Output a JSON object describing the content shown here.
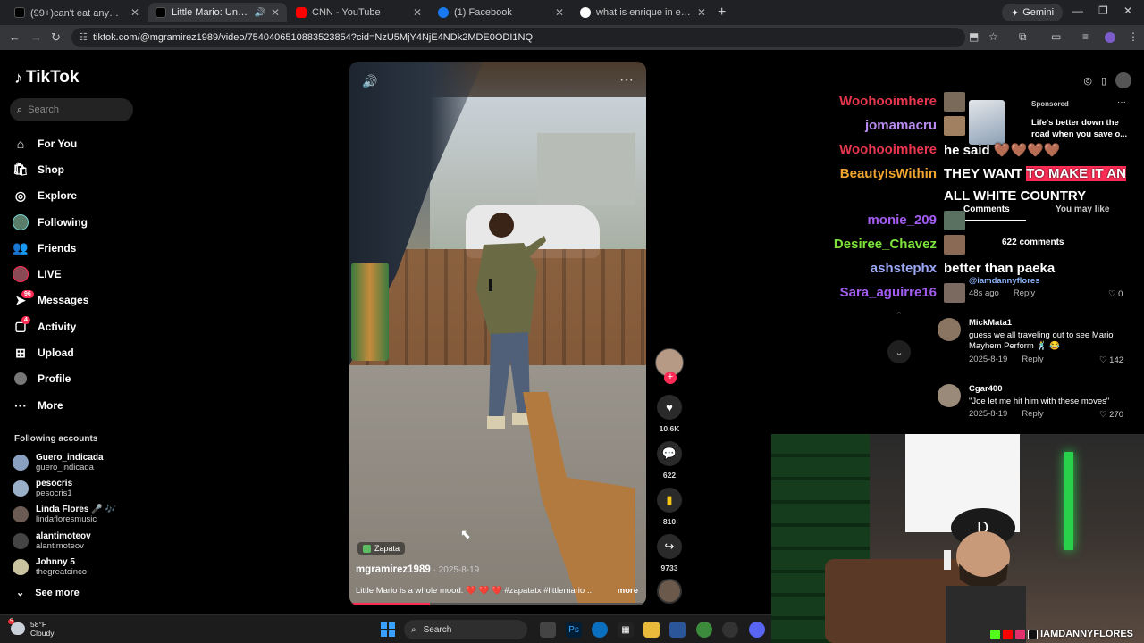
{
  "browser": {
    "tabs": [
      {
        "title": "(99+)can't eat anywhere 🤦‍♀️#fy",
        "favicon": "#000000"
      },
      {
        "title": "Little Mario: Un Mood Únic",
        "favicon": "#000000"
      },
      {
        "title": "CNN - YouTube",
        "favicon": "#ff0000"
      },
      {
        "title": "(1) Facebook",
        "favicon": "#1877f2"
      },
      {
        "title": "what is enrique in english - Go",
        "favicon": "#4285f4"
      }
    ],
    "gemini_label": "Gemini",
    "url": "tiktok.com/@mgramirez1989/video/7540406510883523854?cid=NzU5MjY4NjE4NDk2MDE0ODI1NQ"
  },
  "tiktok": {
    "logo": "TikTok",
    "search_placeholder": "Search",
    "nav": [
      {
        "label": "For You",
        "icon": "home-icon"
      },
      {
        "label": "Shop",
        "icon": "shop-icon"
      },
      {
        "label": "Explore",
        "icon": "compass-icon"
      },
      {
        "label": "Following",
        "icon": "following-icon"
      },
      {
        "label": "Friends",
        "icon": "friends-icon"
      },
      {
        "label": "LIVE",
        "icon": "live-icon"
      },
      {
        "label": "Messages",
        "icon": "messages-icon",
        "badge": "96"
      },
      {
        "label": "Activity",
        "icon": "activity-icon",
        "badge": "4"
      },
      {
        "label": "Upload",
        "icon": "upload-icon"
      },
      {
        "label": "Profile",
        "icon": "profile-icon"
      },
      {
        "label": "More",
        "icon": "more-icon"
      }
    ],
    "following_title": "Following accounts",
    "following": [
      {
        "name": "Guero_indicada",
        "handle": "guero_indicada"
      },
      {
        "name": "pesocris",
        "handle": "pesocris1"
      },
      {
        "name": "Linda Flores 🎤 🎶",
        "handle": "lindafloresmusic"
      },
      {
        "name": "alantimoteov",
        "handle": "alantimoteov"
      },
      {
        "name": "Johnny 5",
        "handle": "thegreatcinco"
      }
    ],
    "see_more": "See more",
    "video": {
      "location": "Zapata",
      "author": "mgramirez1989",
      "date": " · 2025-8-19",
      "caption": "Little Mario is a whole mood. ❤️ ❤️ ❤️ #zapatatx #littlemario ...",
      "more": "more",
      "progress": 0.27
    },
    "actions": {
      "likes": "10.6K",
      "comments": "622",
      "saves": "810",
      "shares": "9733"
    }
  },
  "stream_chat": [
    {
      "name": "Woohooimhere",
      "color": "#e8364f"
    },
    {
      "name": "jomamacru",
      "color": "#b98cf0"
    },
    {
      "name": "Woohooimhere",
      "color": "#e8364f"
    },
    {
      "name": "BeautyIsWithin",
      "color": "#f0a530"
    },
    {
      "name": "monie_209",
      "color": "#a35cf0"
    },
    {
      "name": "Desiree_Chavez",
      "color": "#7de23b"
    },
    {
      "name": "ashstephx",
      "color": "#9aa7f5"
    },
    {
      "name": "Sara_aguirre16",
      "color": "#a35cf0"
    }
  ],
  "stream_messages": {
    "m1": "he said 🤎🤎🤎🤎",
    "m2a": "THEY WANT ",
    "m2b": "TO MAKE IT AN",
    "m2c": "ALL WHITE COUNTRY",
    "m3": "better than paeka"
  },
  "comments_panel": {
    "sponsored": "Sponsored",
    "ad_text": "Life's better down the road when you save o...",
    "tab_comments": "Comments",
    "tab_you_may_like": "You may like",
    "count": "622 comments",
    "comments": [
      {
        "user": "@iamdannyflores",
        "text": "",
        "date": "48s ago",
        "reply": "Reply",
        "likes": "0"
      },
      {
        "user": "MickMata1",
        "text": "guess we all traveling out to see Mario Mayhem Perform 🕺 😂",
        "date": "2025-8-19",
        "reply": "Reply",
        "likes": "142"
      },
      {
        "user": "Cgar400",
        "text": "\"Joe let me hit him with these moves\"",
        "date": "2025-8-19",
        "reply": "Reply",
        "likes": "270"
      }
    ]
  },
  "webcam": {
    "handle": "IAMDANNYFLORES",
    "social_colors": [
      "#53fc18",
      "#ff0000",
      "#e1306c",
      "#000000"
    ]
  },
  "taskbar": {
    "temp": "58°F",
    "condition": "Cloudy",
    "weather_badge": "5",
    "search": "Search"
  }
}
